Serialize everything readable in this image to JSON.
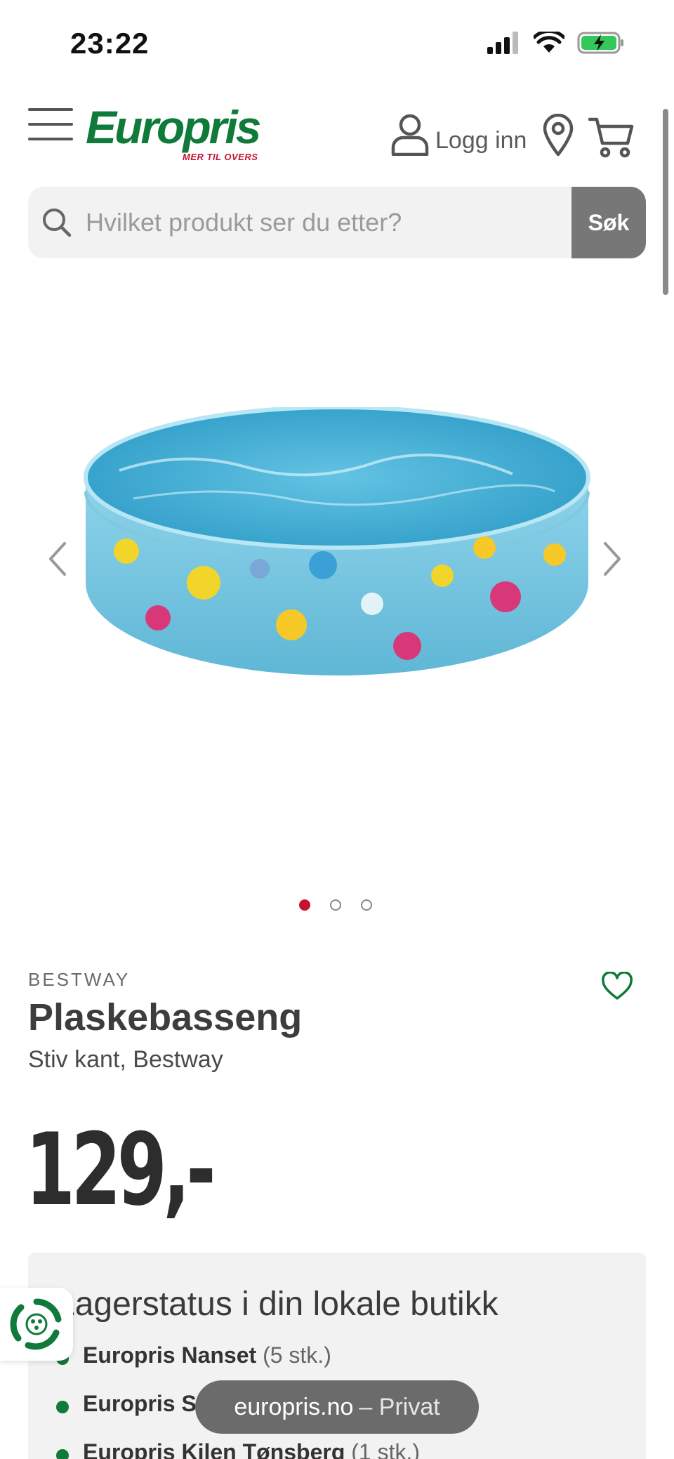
{
  "status_bar": {
    "time": "23:22"
  },
  "header": {
    "logo_text": "Europris",
    "logo_tagline": "MER TIL OVERS",
    "login_label": "Logg inn"
  },
  "search": {
    "placeholder": "Hvilket produkt ser du etter?",
    "button_label": "Søk"
  },
  "gallery": {
    "image_icon": "inflatable-pool-image",
    "total_images": 3,
    "active_index": 0
  },
  "product": {
    "brand": "BESTWAY",
    "title": "Plaskebasseng",
    "subtitle": "Stiv kant, Bestway",
    "price": "129,-"
  },
  "stock": {
    "title": "Lagerstatus i din lokale butikk",
    "stores": [
      {
        "name": "Europris Nanset",
        "qty": "(5 stk.)"
      },
      {
        "name": "Europris S",
        "qty": ""
      },
      {
        "name": "Europris Kilen Tønsberg",
        "qty": "(1 stk.)"
      }
    ]
  },
  "browser": {
    "domain": "europris.no",
    "mode": "– Privat"
  },
  "colors": {
    "brand_green": "#0f7a3a",
    "brand_red": "#c4122f",
    "search_button": "#777777"
  }
}
